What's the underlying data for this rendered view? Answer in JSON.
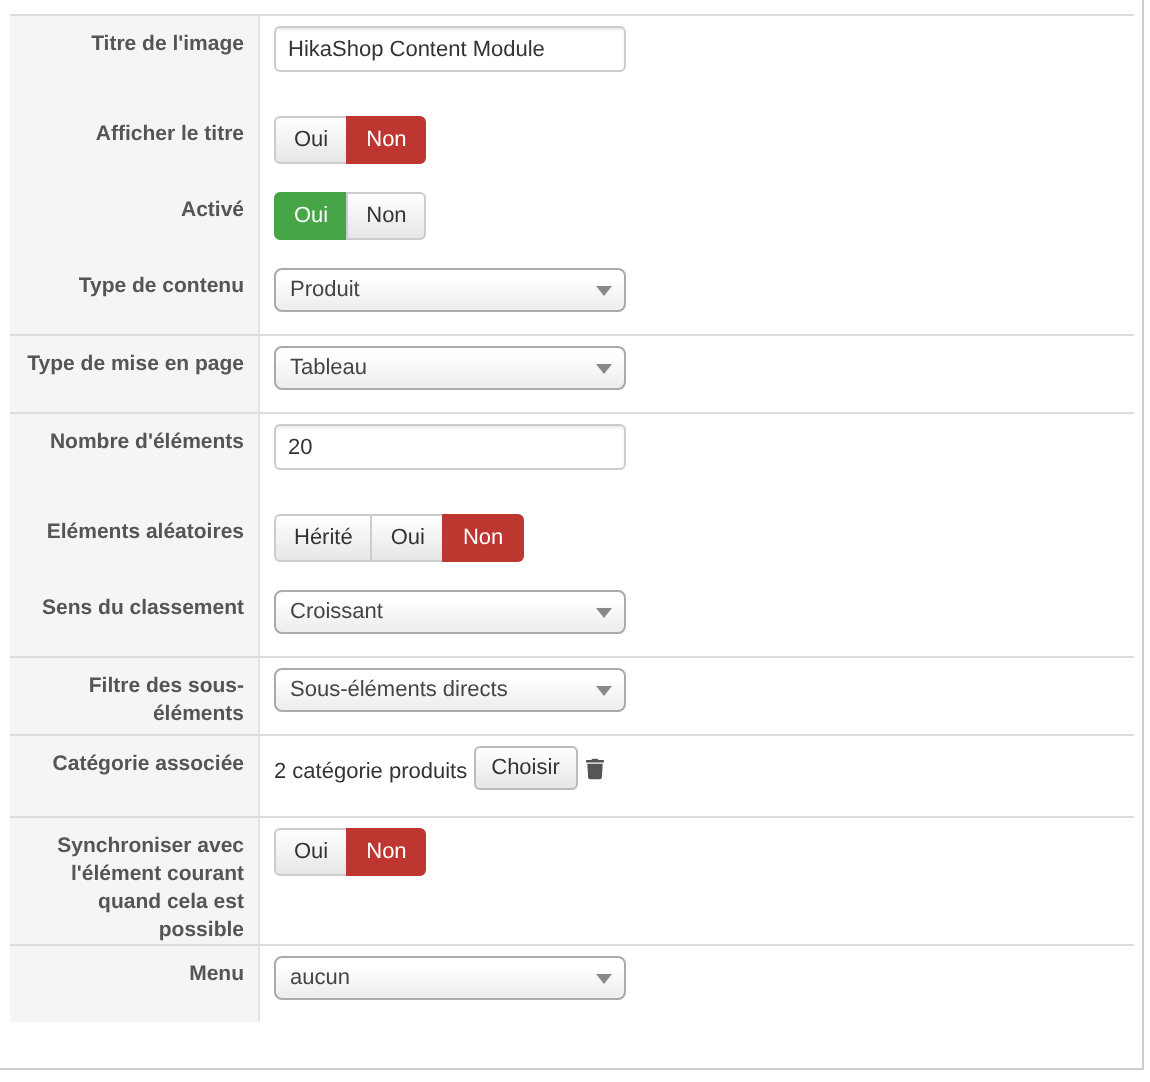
{
  "sections": [
    {
      "fields": [
        {
          "kind": "text",
          "label": "Titre de l'image",
          "value": "HikaShop Content Module"
        },
        {
          "kind": "toggle",
          "label": "Afficher le titre",
          "color": "#bd362f",
          "options": [
            {
              "label": "Oui",
              "selected": false
            },
            {
              "label": "Non",
              "selected": true
            }
          ]
        },
        {
          "kind": "toggle",
          "label": "Activé",
          "color": "#46a546",
          "options": [
            {
              "label": "Oui",
              "selected": true
            },
            {
              "label": "Non",
              "selected": false
            }
          ]
        },
        {
          "kind": "select",
          "label": "Type de contenu",
          "value": "Produit"
        }
      ]
    },
    {
      "fields": [
        {
          "kind": "select",
          "label": "Type de mise en page",
          "value": "Tableau"
        }
      ]
    },
    {
      "fields": [
        {
          "kind": "text",
          "label": "Nombre d'éléments",
          "value": "20"
        },
        {
          "kind": "toggle",
          "label": "Eléments aléatoires",
          "color": "#bd362f",
          "options": [
            {
              "label": "Hérité",
              "selected": false
            },
            {
              "label": "Oui",
              "selected": false
            },
            {
              "label": "Non",
              "selected": true
            }
          ]
        },
        {
          "kind": "select",
          "label": "Sens du classement",
          "value": "Croissant"
        }
      ]
    },
    {
      "fields": [
        {
          "kind": "select",
          "label": "Filtre des sous-éléments",
          "value": "Sous-éléments directs"
        }
      ]
    },
    {
      "fields": [
        {
          "kind": "category",
          "label": "Catégorie associée",
          "value": "2 catégorie produits",
          "button": "Choisir"
        }
      ]
    },
    {
      "fields": [
        {
          "kind": "toggle",
          "label": "Synchroniser avec l'élément courant quand cela est possible",
          "color": "#bd362f",
          "options": [
            {
              "label": "Oui",
              "selected": false
            },
            {
              "label": "Non",
              "selected": true
            }
          ]
        }
      ]
    },
    {
      "fields": [
        {
          "kind": "select",
          "label": "Menu",
          "value": "aucun"
        }
      ]
    }
  ]
}
